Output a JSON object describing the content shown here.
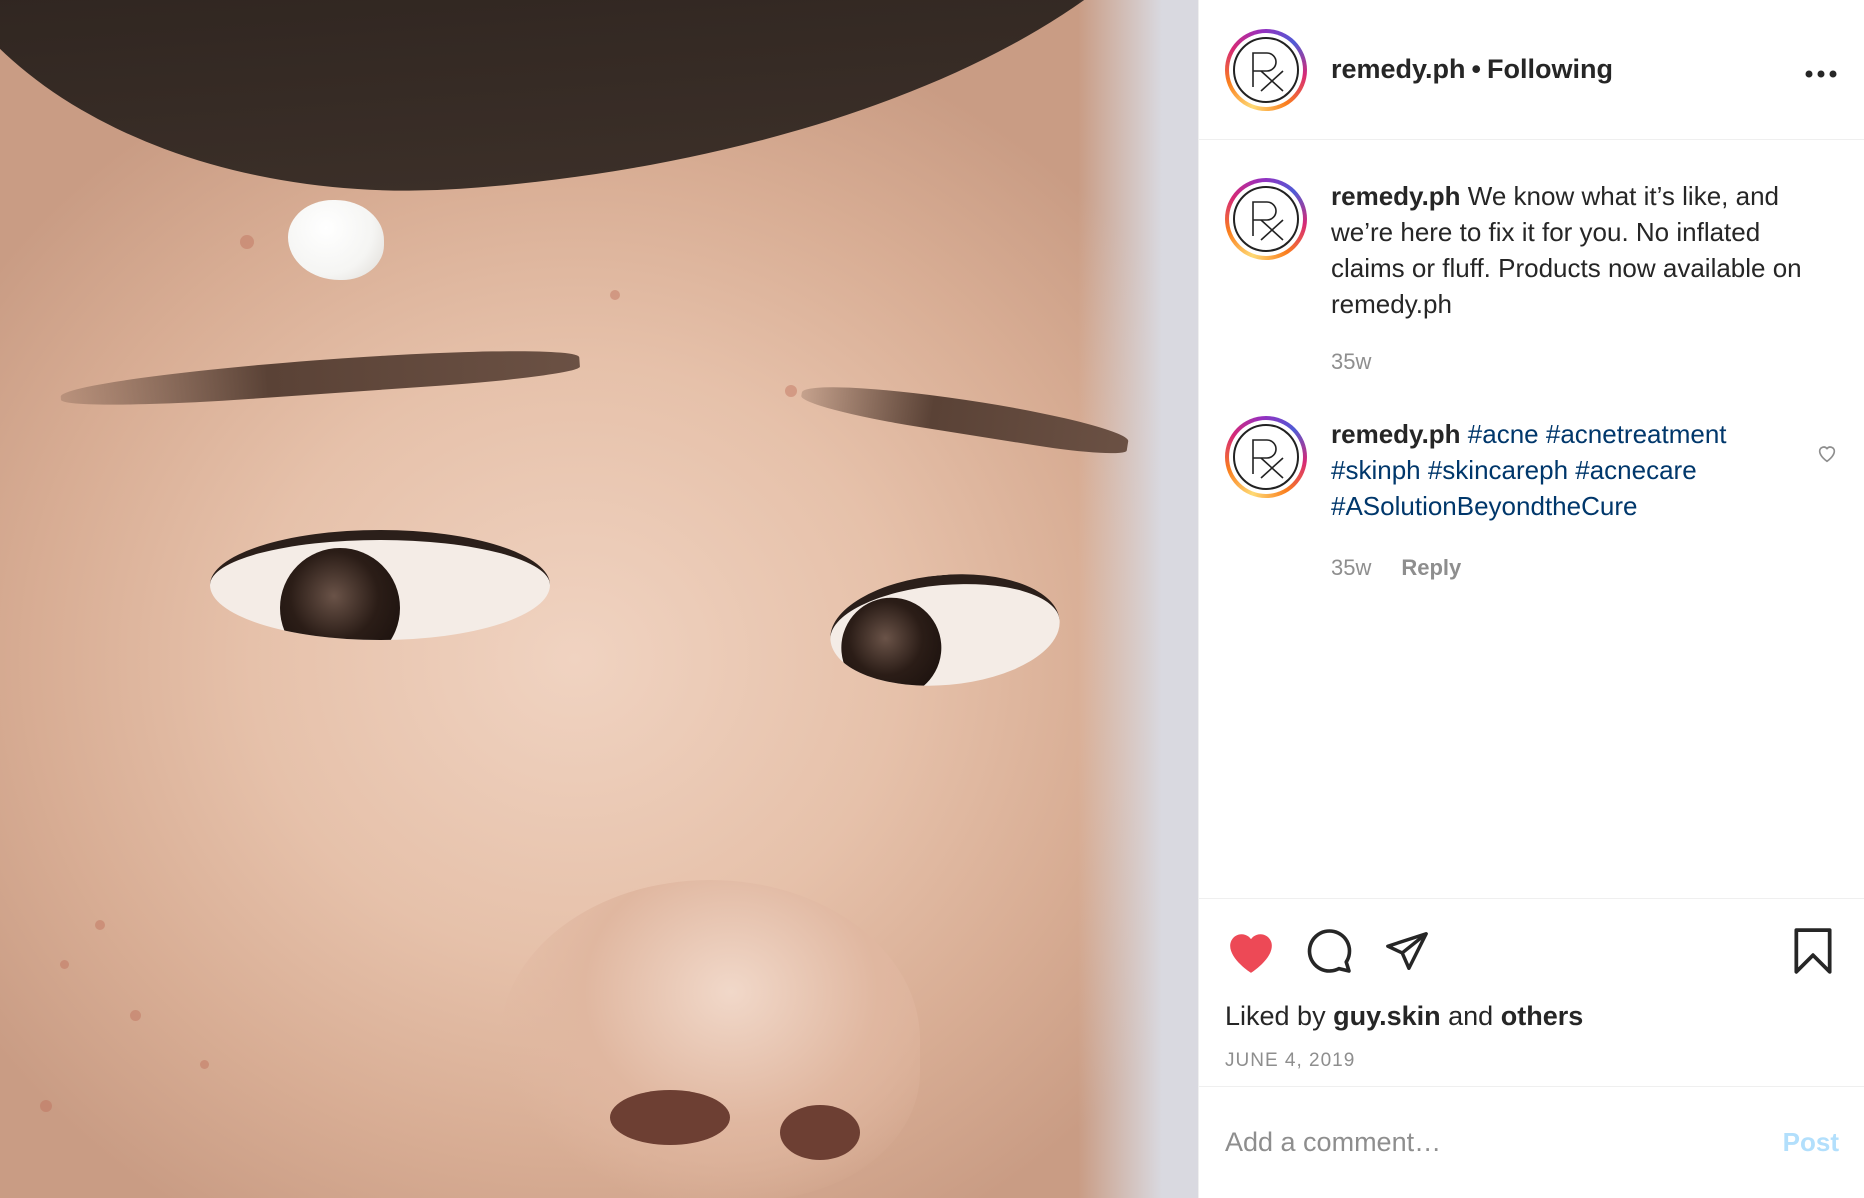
{
  "header": {
    "username": "remedy.ph",
    "separator": "•",
    "follow_status": "Following",
    "more_icon": "more-horizontal-icon"
  },
  "caption": {
    "username": "remedy.ph",
    "text": "We know what it’s like, and we’re here to fix it for you. No inflated claims or fluff. Products now available on remedy.ph",
    "age": "35w"
  },
  "comments": [
    {
      "username": "remedy.ph",
      "hashtags": "#acne #acnetreatment #skinph #skincareph #acnecare #ASolutionBeyondtheCure",
      "age": "35w",
      "reply_label": "Reply"
    }
  ],
  "actions": {
    "like_icon": "heart-filled-icon",
    "comment_icon": "comment-icon",
    "share_icon": "send-icon",
    "save_icon": "bookmark-icon",
    "liked_color": "#ed4956"
  },
  "likes": {
    "prefix": "Liked by",
    "user": "guy.skin",
    "conjunction": "and",
    "others": "others"
  },
  "date": "JUNE 4, 2019",
  "add_comment": {
    "placeholder": "Add a comment…",
    "post_label": "Post"
  }
}
